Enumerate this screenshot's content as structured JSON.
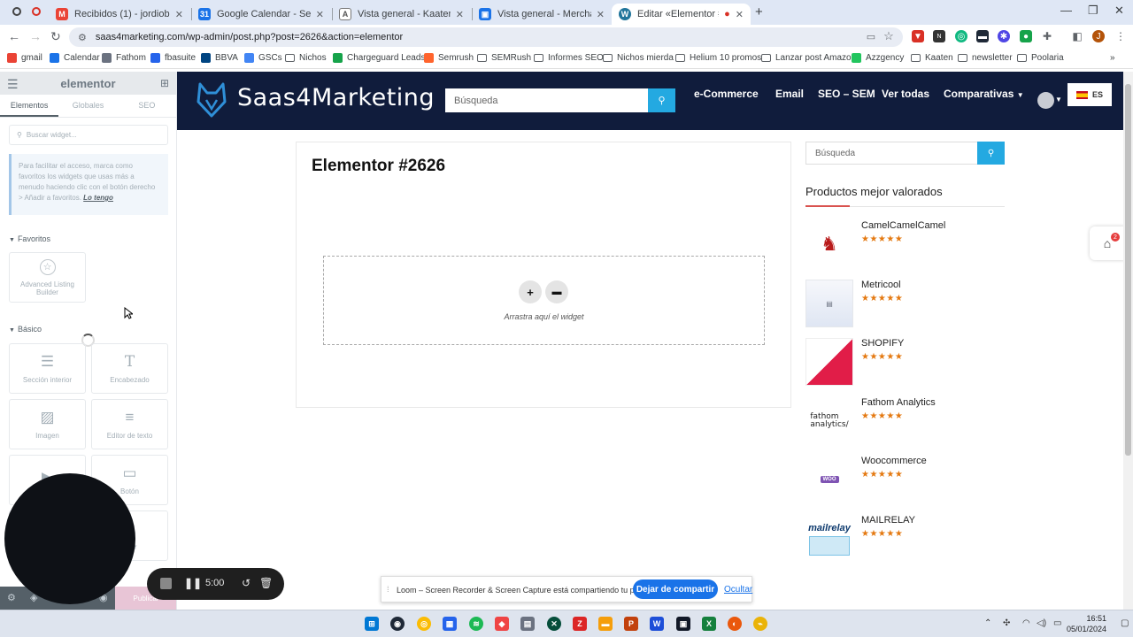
{
  "browser": {
    "tabs": [
      {
        "title": "Recibidos (1) - jordiob@gmail.c",
        "favicon": "gmail-icon"
      },
      {
        "title": "Google Calendar - Semana del",
        "favicon": "calendar-icon"
      },
      {
        "title": "Vista general - Kaaten - Googl",
        "favicon": "google-ads-icon"
      },
      {
        "title": "Vista general - Merchant Cente",
        "favicon": "merchant-center-icon"
      },
      {
        "title": "Editar «Elementor #2626» c",
        "favicon": "wordpress-icon",
        "active": true
      }
    ],
    "new_tab": "+",
    "window_controls": {
      "minimize": "—",
      "maximize": "❐",
      "close": "✕"
    },
    "url": "saas4marketing.com/wp-admin/post.php?post=2626&action=elementor",
    "bookmarks": [
      "gmail",
      "Calendar",
      "Fathom",
      "fbasuite",
      "BBVA",
      "GSCs",
      "Nichos",
      "Chargeguard Leads...",
      "Semrush",
      "SEMRush",
      "Informes SEO",
      "Nichos mierda",
      "Helium 10 promos",
      "Lanzar post Amazo...",
      "Azzgency",
      "Kaaten",
      "newsletter",
      "Poolaria"
    ],
    "bookmarks_more": "»"
  },
  "elementor_panel": {
    "logo": "elementor",
    "tabs": [
      "Elementos",
      "Globales",
      "SEO"
    ],
    "search_placeholder": "Buscar widget...",
    "fav_tip": "Para facilitar el acceso, marca como favoritos los widgets que usas más a menudo haciendo clic con el botón derecho > Añadir a favoritos.",
    "fav_tip_link": "Lo tengo",
    "favorites_title": "Favoritos",
    "favorites": [
      {
        "label": "Advanced Listing Builder",
        "icon": "star-icon"
      }
    ],
    "basic_title": "Básico",
    "basic_widgets": [
      {
        "label": "Sección interior",
        "icon": "columns-icon"
      },
      {
        "label": "Encabezado",
        "icon": "heading-icon"
      },
      {
        "label": "Imagen",
        "icon": "image-icon"
      },
      {
        "label": "Editor de texto",
        "icon": "text-editor-icon"
      },
      {
        "label": "",
        "icon": "video-icon"
      },
      {
        "label": "Botón",
        "icon": "button-icon"
      },
      {
        "label": "",
        "icon": "divider-icon"
      },
      {
        "label": "ador",
        "icon": "spacer-icon"
      }
    ],
    "publish_label": "Publicar"
  },
  "site": {
    "brand": "Saas4Marketing",
    "search_placeholder": "Búsqueda",
    "nav": [
      "e-Commerce",
      "Email",
      "SEO – SEM",
      "Ver todas",
      "Comparativas"
    ],
    "language": "ES",
    "page_title": "Elementor #2626",
    "drop_hint": "Arrastra aquí el widget",
    "sidebar_search_placeholder": "Búsqueda",
    "sidebar_title": "Productos mejor valorados",
    "products": [
      {
        "name": "CamelCamelCamel",
        "rating": 5
      },
      {
        "name": "Metricool",
        "rating": 5
      },
      {
        "name": "SHOPIFY",
        "rating": 5
      },
      {
        "name": "Fathom Analytics",
        "rating": 5
      },
      {
        "name": "Woocommerce",
        "rating": 5
      },
      {
        "name": "MAILRELAY",
        "rating": 5
      }
    ],
    "stars_text": "★★★★★",
    "cart_count": "2"
  },
  "loom": {
    "timer": "5:00",
    "message": "Loom – Screen Recorder & Screen Capture está compartiendo tu pantalla.",
    "stop_label": "Dejar de compartir",
    "hide_label": "Ocultar"
  },
  "taskbar": {
    "time": "16:51",
    "date": "05/01/2024"
  },
  "colors": {
    "site_header": "#101c3c",
    "accent_blue": "#24a9e1",
    "stars": "#e47911",
    "loom_blue": "#1a73e8"
  }
}
